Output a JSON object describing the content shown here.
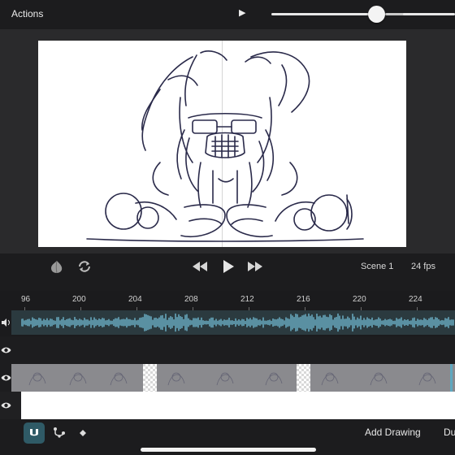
{
  "topbar": {
    "actions_label": "Actions",
    "play_icon": "play-icon",
    "zoom_level": 0.72
  },
  "playback": {
    "onion_icon": "onion-skin-icon",
    "loop_icon": "loop-icon",
    "rewind_icon": "rewind-icon",
    "play_icon": "play-icon",
    "forward_icon": "fast-forward-icon",
    "scene_label": "Scene 1",
    "fps_label": "24 fps"
  },
  "ruler": {
    "labels": [
      "96",
      "200",
      "204",
      "208",
      "212",
      "216",
      "220",
      "224"
    ]
  },
  "tracks": [
    {
      "type": "audio",
      "icon": "speaker-icon"
    },
    {
      "type": "layer",
      "icon": "eye-icon"
    },
    {
      "type": "layer",
      "icon": "eye-icon"
    },
    {
      "type": "layer",
      "icon": "eye-icon"
    }
  ],
  "toolbar": {
    "magnet_icon": "magnet-icon",
    "path_icon": "path-icon",
    "keyframe_icon": "diamond-icon",
    "add_drawing_label": "Add Drawing",
    "duplicate_label": "Du"
  },
  "colors": {
    "audio_wave": "#6fb6cc",
    "active_tool": "#2f5a66",
    "stroke": "#2a2a4a"
  }
}
